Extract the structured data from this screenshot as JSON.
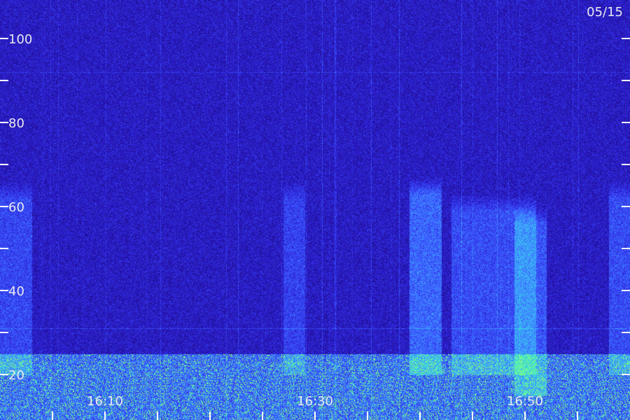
{
  "date_label": "05/15",
  "chart_data": {
    "type": "heatmap",
    "title": "",
    "xlabel": "",
    "ylabel": "",
    "y_ticks_labeled": [
      20,
      40,
      60,
      80,
      100
    ],
    "y_ticks_minor": [
      30,
      50,
      70,
      90
    ],
    "ylim": [
      13,
      107
    ],
    "x_tick_labels": [
      "16:10",
      "16:30",
      "16:50"
    ],
    "x_minor_count_between": 3,
    "colormap": [
      "#000000",
      "#1a0a6e",
      "#2a18c8",
      "#3a50ff",
      "#40a0ff",
      "#30e0e0",
      "#80ff80"
    ],
    "events": [
      {
        "start": "16:00",
        "end": "16:03",
        "fmin": 20,
        "fmax": 66,
        "intensity": 0.55
      },
      {
        "start": "16:27",
        "end": "16:29",
        "fmin": 20,
        "fmax": 66,
        "intensity": 0.5
      },
      {
        "start": "16:39",
        "end": "16:42",
        "fmin": 20,
        "fmax": 67,
        "intensity": 0.85
      },
      {
        "start": "16:43",
        "end": "16:51",
        "fmin": 20,
        "fmax": 63,
        "intensity": 0.6
      },
      {
        "start": "16:49",
        "end": "16:52",
        "fmin": 15,
        "fmax": 60,
        "intensity": 0.7
      },
      {
        "start": "16:58",
        "end": "17:00",
        "fmin": 20,
        "fmax": 66,
        "intensity": 0.6
      }
    ],
    "horizontal_lines": [
      {
        "f": 31,
        "intensity": 0.5
      },
      {
        "f": 92,
        "intensity": 0.35
      }
    ]
  }
}
